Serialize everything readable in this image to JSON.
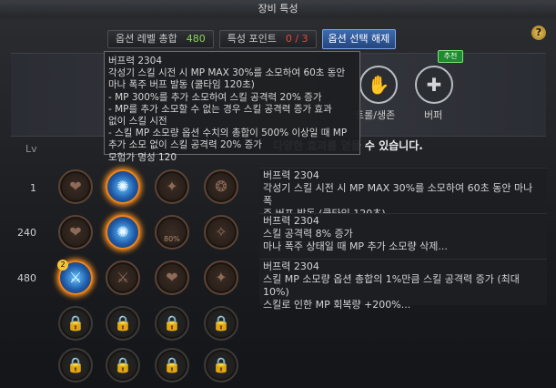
{
  "window": {
    "title": "장비 특성"
  },
  "topbar": {
    "option_level_label": "옵션 레벨 총합",
    "option_level_value": "480",
    "trait_points_label": "특성 포인트",
    "trait_points_value": "0 / 3",
    "reset_button": "옵션 선택 해제"
  },
  "help": {
    "label": "?"
  },
  "categories": [
    {
      "label": "트롤/생존",
      "icon": "support-survival-icon"
    },
    {
      "label": "버퍼",
      "icon": "buffer-icon",
      "badge": "추천"
    }
  ],
  "banner_text": "다양한 효과를 얻을 수 있습니다.",
  "lv_header": "Lv",
  "rows": [
    {
      "level": "1",
      "desc": [
        "버프력 2304",
        "각성기 스킬 시전 시 MP MAX 30%를 소모하여 60초 동안 마나 폭",
        "주 버프 발동 (쿨타임 120초)..."
      ]
    },
    {
      "level": "240",
      "desc": [
        "버프력 2304",
        "스킬 공격력 8% 증가",
        "마나 폭주 상태일 때 MP 추가 소모량 삭제..."
      ]
    },
    {
      "level": "480",
      "desc": [
        "버프력 2304",
        "스킬 MP 소모량 옵션 총합의 1%만큼 스킬 공격력 증가 (최대 10%)",
        "스킬로 인한 MP 회복량 +200%..."
      ]
    }
  ],
  "node_tag_80": "80%",
  "node_num": "2",
  "tooltip": [
    "버프력 2304",
    "각성기 스킬 시전 시 MP MAX 30%를 소모하여 60초 동안",
    "마나 폭주 버프 발동 (쿨타임 120초)",
    "- MP 300%를 추가 소모하여 스킬 공격력 20% 증가",
    "- MP를 추가 소모할 수 없는 경우 스킬 공격력 증가 효과",
    "없이 스킬 시전",
    "- 스킬 MP 소모량 옵션 수치의 총합이 500% 이상일 때 MP",
    "추가 소모 없이 스킬 공격력 20% 증가",
    "모험가 명성 120"
  ],
  "colors": {
    "accent_orange": "#f1841b",
    "selected_blue": "#3ea9f0",
    "highlight_green": "#8fd35a",
    "points_red": "#e6473f"
  }
}
